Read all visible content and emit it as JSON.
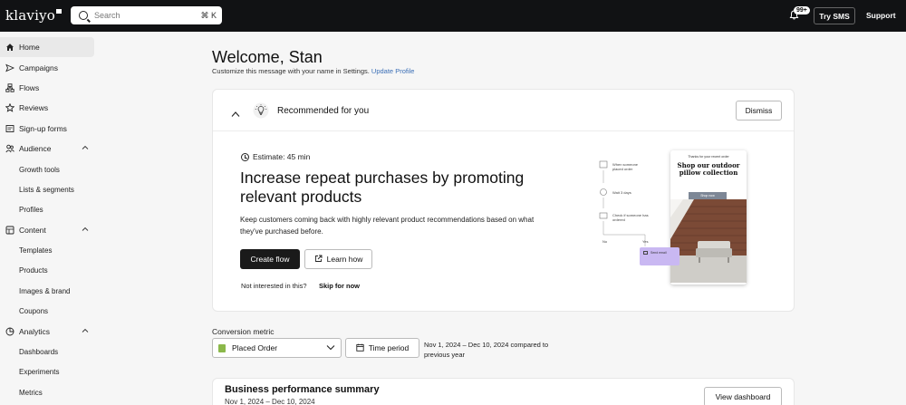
{
  "topbar": {
    "logo": "klaviyo",
    "search_placeholder": "Search",
    "search_shortcut": "⌘ K",
    "notifications_badge": "99+",
    "try_sms": "Try SMS",
    "support": "Support"
  },
  "sidebar": {
    "items": [
      {
        "label": "Home",
        "icon": "home-icon"
      },
      {
        "label": "Campaigns",
        "icon": "megaphone-icon"
      },
      {
        "label": "Flows",
        "icon": "flows-icon"
      },
      {
        "label": "Reviews",
        "icon": "star-icon"
      },
      {
        "label": "Sign-up forms",
        "icon": "form-icon"
      },
      {
        "label": "Audience",
        "icon": "people-icon"
      },
      {
        "label": "Content",
        "icon": "content-icon"
      },
      {
        "label": "Analytics",
        "icon": "analytics-icon"
      }
    ],
    "audience_sub": [
      "Growth tools",
      "Lists & segments",
      "Profiles"
    ],
    "content_sub": [
      "Templates",
      "Products",
      "Images & brand",
      "Coupons"
    ],
    "analytics_sub": [
      "Dashboards",
      "Experiments",
      "Metrics"
    ]
  },
  "main": {
    "welcome": "Welcome, Stan",
    "customize_text": "Customize this message with your name in Settings.",
    "update_profile": "Update Profile",
    "recommended": {
      "title": "Recommended for you",
      "dismiss": "Dismiss",
      "estimate": "Estimate: 45 min",
      "headline": "Increase repeat purchases by promoting relevant products",
      "description": "Keep customers coming back with highly relevant product recommendations based on what they've purchased before.",
      "create_flow": "Create flow",
      "learn_how": "Learn how",
      "not_interested": "Not interested in this?",
      "skip": "Skip for now"
    },
    "illustration": {
      "node1": "When someone placed order",
      "node2": "Wait 3 days",
      "node3": "Check if someone has ordered",
      "no": "No",
      "yes": "Yes",
      "purple": "Send email",
      "phone_thanks": "Thanks for your recent order",
      "phone_title": "Shop our outdoor pillow collection",
      "phone_button": "Shop now"
    },
    "conversion": {
      "label": "Conversion metric",
      "metric": "Placed Order",
      "time_period": "Time period",
      "date_range": "Nov 1, 2024 – Dec 10, 2024 compared to previous year"
    },
    "business": {
      "title": "Business performance summary",
      "date": "Nov 1, 2024 – Dec 10, 2024",
      "view_dashboard": "View dashboard"
    }
  }
}
